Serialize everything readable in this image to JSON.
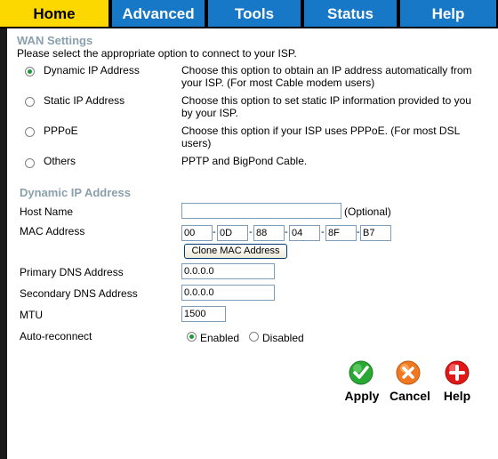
{
  "tabs": [
    "Home",
    "Advanced",
    "Tools",
    "Status",
    "Help"
  ],
  "wan": {
    "title": "WAN Settings",
    "intro": "Please select the appropriate option to connect to your ISP.",
    "options": [
      {
        "label": "Dynamic IP Address",
        "desc": "Choose this option to obtain an IP address automatically from your ISP. (For most Cable modem users)",
        "selected": true
      },
      {
        "label": "Static IP Address",
        "desc": "Choose this option to set static IP information provided to you by your ISP.",
        "selected": false
      },
      {
        "label": "PPPoE",
        "desc": "Choose this option if your ISP uses PPPoE. (For most DSL users)",
        "selected": false
      },
      {
        "label": "Others",
        "desc": "PPTP and BigPond Cable.",
        "selected": false
      }
    ]
  },
  "dynamic": {
    "title": "Dynamic IP Address",
    "host_name_label": "Host Name",
    "host_name_value": "",
    "optional": "(Optional)",
    "mac_label": "MAC Address",
    "mac": [
      "00",
      "0D",
      "88",
      "04",
      "8F",
      "B7"
    ],
    "mac_sep": "-",
    "clone_button": "Clone MAC Address",
    "primary_dns_label": "Primary DNS Address",
    "primary_dns": "0.0.0.0",
    "secondary_dns_label": "Secondary DNS Address",
    "secondary_dns": "0.0.0.0",
    "mtu_label": "MTU",
    "mtu": "1500",
    "auto_label": "Auto-reconnect",
    "auto_enabled": "Enabled",
    "auto_disabled": "Disabled",
    "auto_selected": "Enabled"
  },
  "actions": {
    "apply": "Apply",
    "cancel": "Cancel",
    "help": "Help"
  },
  "colors": {
    "tab_active": "#fcd800",
    "tab": "#1878c8",
    "section_title": "#8aa0ad",
    "radio_dot": "#1a9c3c",
    "apply": "#2aa834",
    "cancel": "#f07820",
    "help": "#e01818"
  }
}
